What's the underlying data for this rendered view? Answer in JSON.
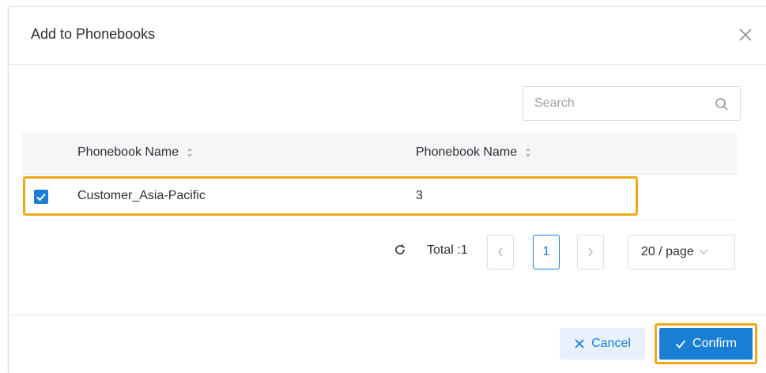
{
  "dialog": {
    "title": "Add to Phonebooks"
  },
  "search": {
    "placeholder": "Search"
  },
  "table": {
    "columns": [
      "Phonebook Name",
      "Phonebook Name"
    ],
    "rows": [
      {
        "checked": true,
        "cells": [
          "Customer_Asia-Pacific",
          "3"
        ]
      }
    ]
  },
  "pagination": {
    "total_label": "Total :1",
    "current_page": "1",
    "page_size": "20 / page"
  },
  "footer": {
    "cancel_label": "Cancel",
    "confirm_label": "Confirm"
  },
  "colors": {
    "primary": "#1a7fd4",
    "highlight": "#f0a81b",
    "cancel_bg": "#e6f1fb"
  },
  "icons": [
    "close-icon",
    "search-icon",
    "sort-icon",
    "checkbox-checked-icon",
    "refresh-icon",
    "chevron-left-icon",
    "chevron-right-icon",
    "chevron-down-icon",
    "x-icon",
    "check-icon"
  ]
}
